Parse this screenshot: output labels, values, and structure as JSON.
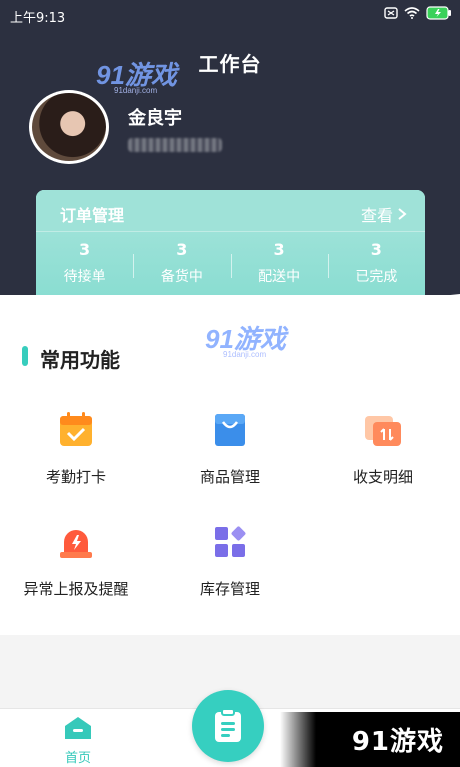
{
  "status_bar": {
    "time": "上午9:13"
  },
  "header": {
    "title": "工作台",
    "username": "金良宇"
  },
  "order_card": {
    "title": "订单管理",
    "view_label": "查看",
    "stats": [
      {
        "value": "3",
        "label": "待接单"
      },
      {
        "value": "3",
        "label": "备货中"
      },
      {
        "value": "3",
        "label": "配送中"
      },
      {
        "value": "3",
        "label": "已完成"
      }
    ]
  },
  "functions": {
    "title": "常用功能",
    "items": [
      {
        "label": "考勤打卡",
        "icon": "calendar-check-icon"
      },
      {
        "label": "商品管理",
        "icon": "shopping-bag-icon"
      },
      {
        "label": "收支明细",
        "icon": "transfer-cards-icon"
      },
      {
        "label": "异常上报及提醒",
        "icon": "alarm-light-icon"
      },
      {
        "label": "库存管理",
        "icon": "inventory-grid-icon"
      }
    ]
  },
  "bottom_nav": {
    "home_label": "首页"
  },
  "watermark": {
    "brand_corner": "91游戏",
    "logo_text": "91游戏",
    "logo_subtext": "91danji.com"
  },
  "colors": {
    "header_bg": "#2c3040",
    "accent_teal": "#36cfc0",
    "card_teal": "#9fe2d8",
    "orange": "#ff9a2a",
    "blue": "#3b8eea",
    "purple": "#7a6ee8",
    "red": "#ff5a3c"
  }
}
